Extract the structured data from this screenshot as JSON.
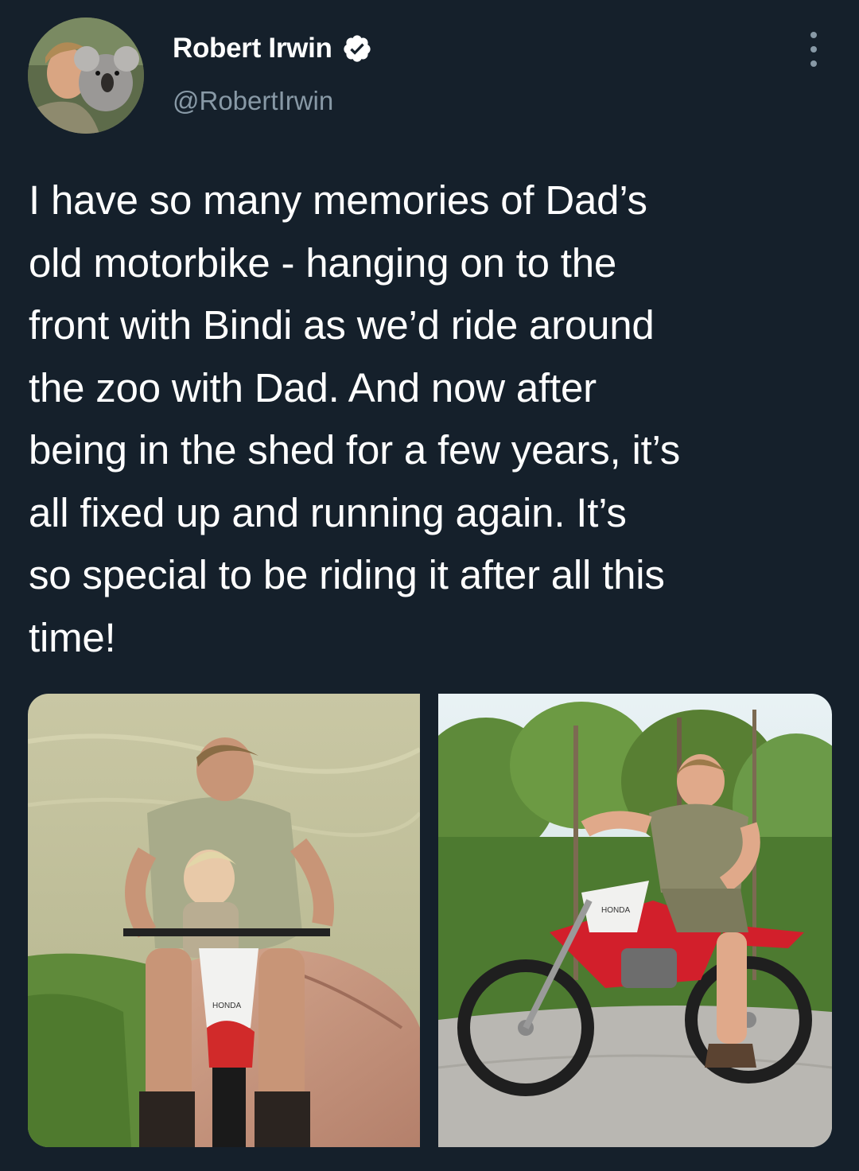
{
  "tweet": {
    "author": {
      "display_name": "Robert Irwin",
      "handle": "@RobertIrwin",
      "verified": true,
      "avatar_icon": "avatar-photo"
    },
    "more_icon": "more-options-icon",
    "text": "I have so many memories of Dad’s\nold motorbike - hanging on to the\nfront with Bindi as we’d ride around\nthe zoo with Dad. And now after\nbeing in the shed for a few years, it’s\nall fixed up and running again. It’s\nso special to be riding it after all this\ntime!",
    "media": [
      {
        "kind": "photo",
        "label": "HONDA"
      },
      {
        "kind": "photo",
        "label": "HONDA"
      }
    ]
  },
  "colors": {
    "background": "#15202b",
    "text_primary": "#ffffff",
    "text_secondary": "#8899a6",
    "verified_badge": "#ffffff"
  }
}
